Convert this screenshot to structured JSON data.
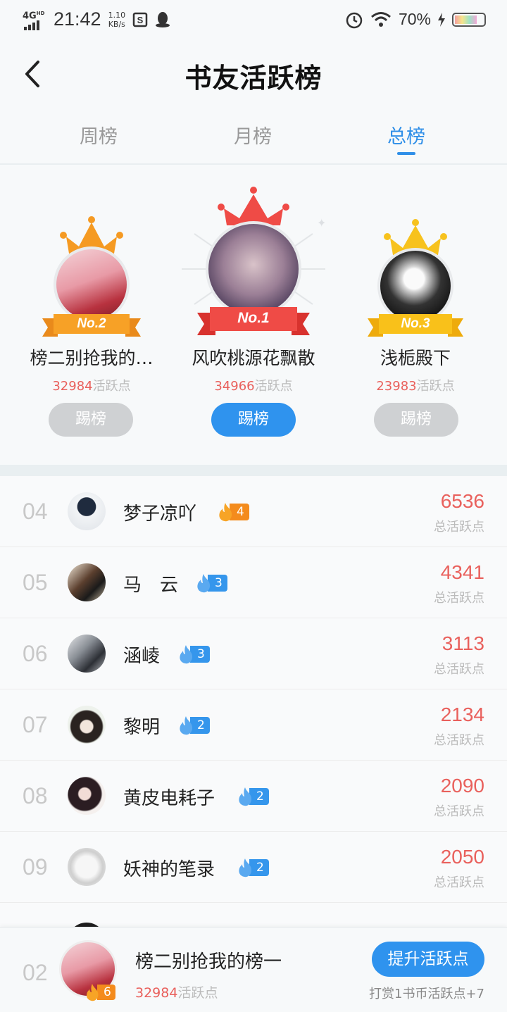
{
  "status_bar": {
    "network": "4G",
    "network_sup": "HD",
    "time": "21:42",
    "speed_value": "1.10",
    "speed_unit": "KB/s",
    "battery": "70%"
  },
  "header": {
    "title": "书友活跃榜"
  },
  "tabs": [
    {
      "label": "周榜",
      "active": false
    },
    {
      "label": "月榜",
      "active": false
    },
    {
      "label": "总榜",
      "active": true
    }
  ],
  "podium": [
    {
      "rank_label": "No.2",
      "name": "榜二别抢我的…",
      "points": "32984",
      "points_suffix": "活跃点",
      "button": "踢榜",
      "crown_color": "#f59a22"
    },
    {
      "rank_label": "No.1",
      "name": "风吹桃源花飘散",
      "points": "34966",
      "points_suffix": "活跃点",
      "button": "踢榜",
      "crown_color": "#ef4b46"
    },
    {
      "rank_label": "No.3",
      "name": "浅栀殿下",
      "points": "23983",
      "points_suffix": "活跃点",
      "button": "踢榜",
      "crown_color": "#f7c21d"
    }
  ],
  "list": [
    {
      "rank": "04",
      "name": "梦子凉吖",
      "level": "4",
      "badge": "orange",
      "score": "6536",
      "score_label": "总活跃点"
    },
    {
      "rank": "05",
      "name": "马　云",
      "level": "3",
      "badge": "blue",
      "score": "4341",
      "score_label": "总活跃点"
    },
    {
      "rank": "06",
      "name": "涵崚",
      "level": "3",
      "badge": "blue",
      "score": "3113",
      "score_label": "总活跃点"
    },
    {
      "rank": "07",
      "name": "黎明",
      "level": "2",
      "badge": "blue",
      "score": "2134",
      "score_label": "总活跃点"
    },
    {
      "rank": "08",
      "name": "黄皮电耗子",
      "level": "2",
      "badge": "blue",
      "score": "2090",
      "score_label": "总活跃点"
    },
    {
      "rank": "09",
      "name": "妖神的笔录",
      "level": "2",
      "badge": "blue",
      "score": "2050",
      "score_label": "总活跃点"
    }
  ],
  "me": {
    "rank": "02",
    "name": "榜二别抢我的榜一",
    "level": "6",
    "points": "32984",
    "points_suffix": "活跃点",
    "boost_button": "提升活跃点",
    "hint": "打赏1书币活跃点+7"
  }
}
